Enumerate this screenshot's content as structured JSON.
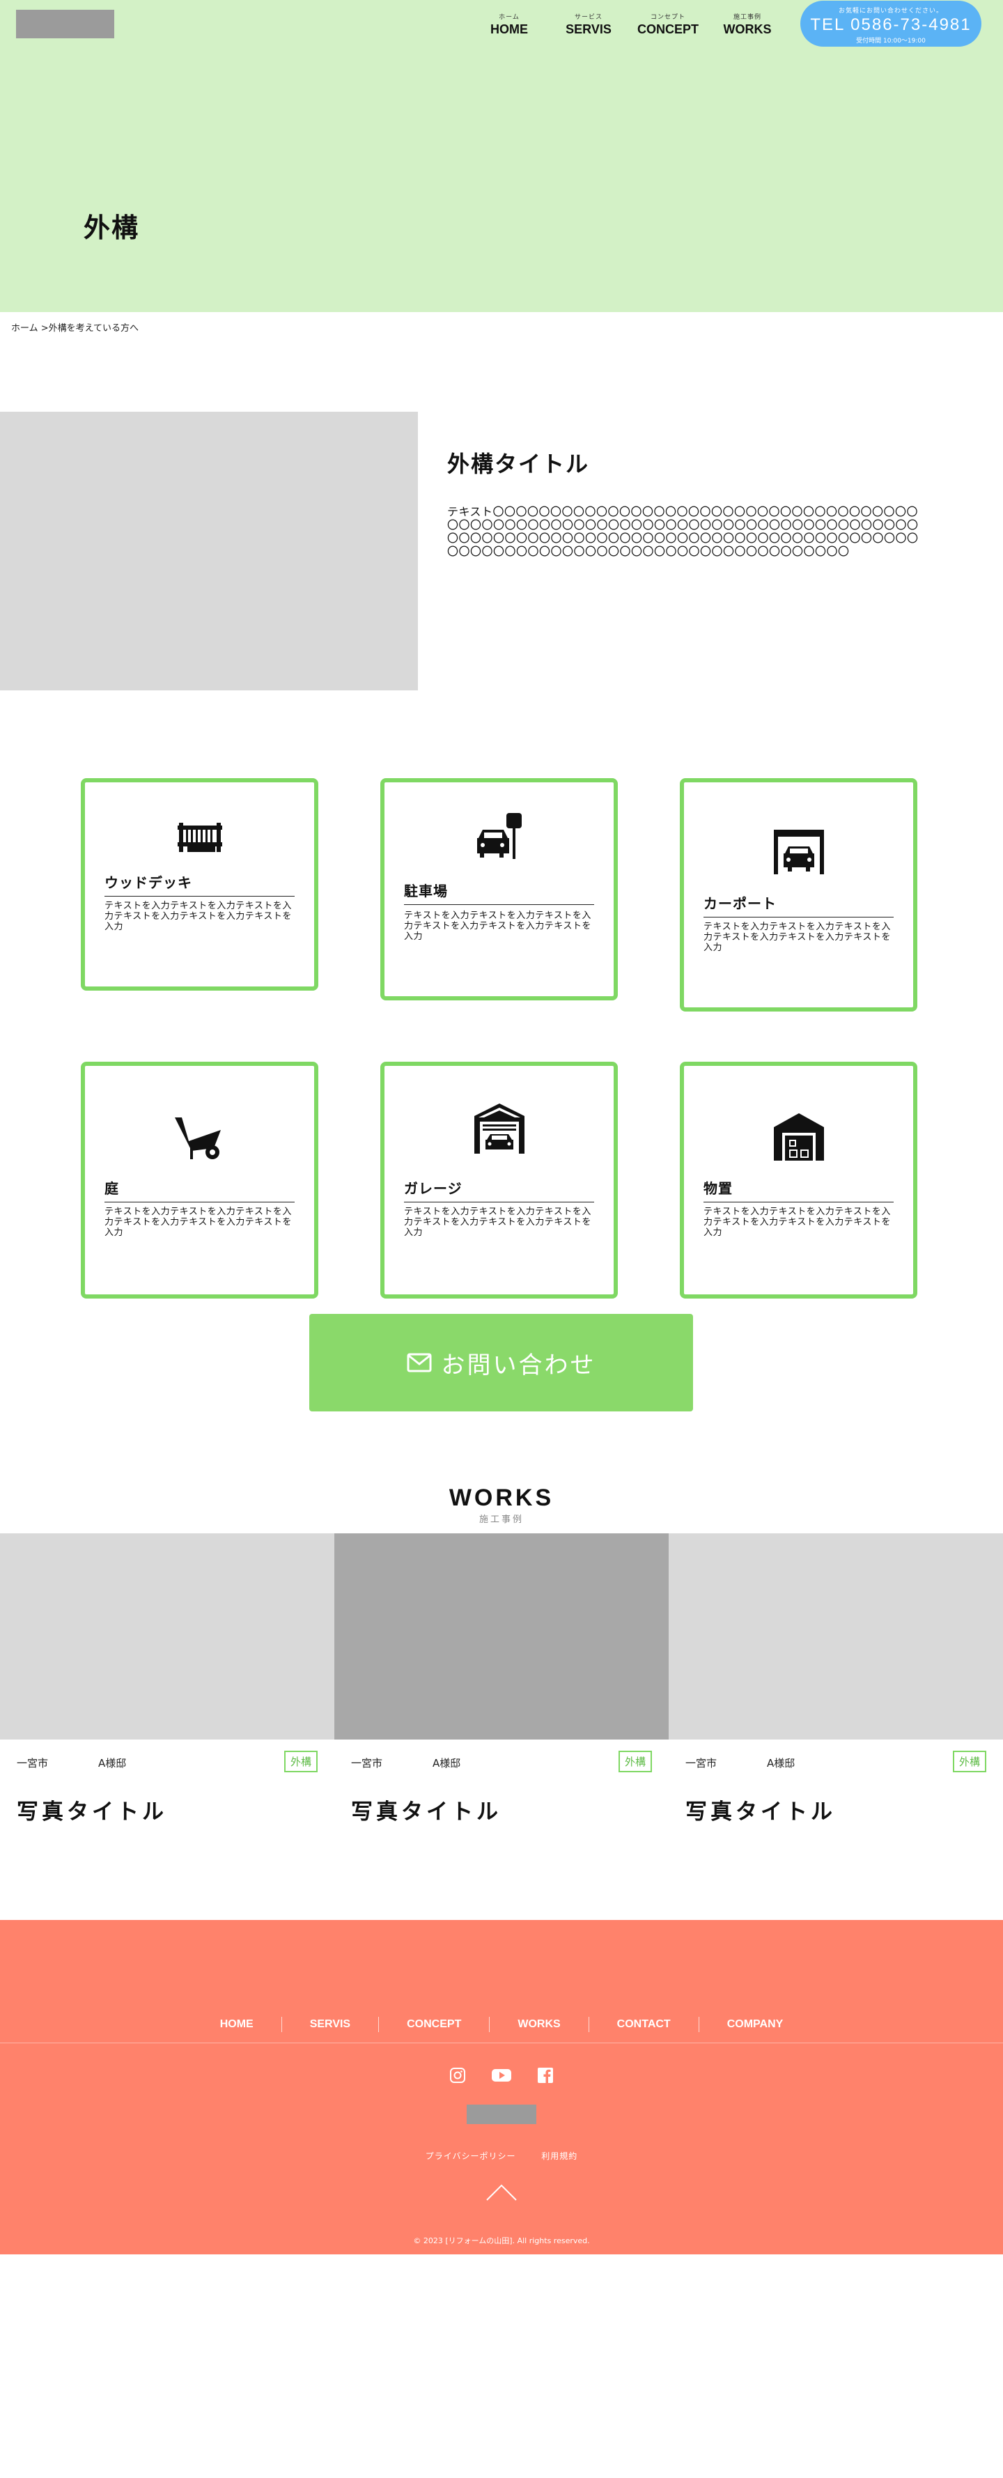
{
  "header": {
    "nav": [
      {
        "sub": "ホーム",
        "label": "HOME"
      },
      {
        "sub": "サービス",
        "label": "SERVIS"
      },
      {
        "sub": "コンセプト",
        "label": "CONCEPT"
      },
      {
        "sub": "施工事例",
        "label": "WORKS"
      }
    ],
    "tel": {
      "note": "お気軽にお問い合わせください。",
      "number": "TEL 0586-73-4981",
      "hours": "受付時間 10:00〜19:00"
    },
    "accent_color": "#d3f1c6",
    "tel_color": "#5bb3f5"
  },
  "hero": {
    "title": "外構"
  },
  "breadcrumb": {
    "home": "ホーム",
    "separator": " >",
    "current": "外構を考えている方へ"
  },
  "intro": {
    "title": "外構タイトル",
    "text": "テキスト〇〇〇〇〇〇〇〇〇〇〇〇〇〇〇〇〇〇〇〇〇〇〇〇〇〇〇〇〇〇〇〇〇〇〇〇〇〇〇〇〇〇〇〇〇〇〇〇〇〇〇〇〇〇〇〇〇〇〇〇〇〇〇〇〇〇〇〇〇〇〇〇〇〇〇〇〇〇〇〇〇〇〇〇〇〇〇〇〇〇〇〇〇〇〇〇〇〇〇〇〇〇〇〇〇〇〇〇〇〇〇〇〇〇〇〇〇〇〇〇〇〇〇〇〇〇〇〇〇〇〇〇〇〇〇〇〇〇〇〇〇〇〇〇〇〇〇〇〇〇〇〇〇〇"
  },
  "services": [
    {
      "icon": "wood-deck-icon",
      "title": "ウッドデッキ",
      "text": "テキストを入力テキストを入力テキストを入力テキストを入力テキストを入力テキストを入力"
    },
    {
      "icon": "parking-icon",
      "title": "駐車場",
      "text": "テキストを入力テキストを入力テキストを入力テキストを入力テキストを入力テキストを入力"
    },
    {
      "icon": "carport-icon",
      "title": "カーポート",
      "text": "テキストを入力テキストを入力テキストを入力テキストを入力テキストを入力テキストを入力"
    },
    {
      "icon": "wheelbarrow-icon",
      "title": "庭",
      "text": "テキストを入力テキストを入力テキストを入力テキストを入力テキストを入力テキストを入力"
    },
    {
      "icon": "garage-icon",
      "title": "ガレージ",
      "text": "テキストを入力テキストを入力テキストを入力テキストを入力テキストを入力テキストを入力"
    },
    {
      "icon": "storage-icon",
      "title": "物置",
      "text": "テキストを入力テキストを入力テキストを入力テキストを入力テキストを入力テキストを入力"
    }
  ],
  "contact": {
    "label": "お問い合わせ",
    "color": "#8ad96a"
  },
  "works": {
    "title": "WORKS",
    "subtitle": "施工事例",
    "items": [
      {
        "area": "一宮市",
        "client": "A様邸",
        "tag": "外構",
        "title": "写真タイトル"
      },
      {
        "area": "一宮市",
        "client": "A様邸",
        "tag": "外構",
        "title": "写真タイトル"
      },
      {
        "area": "一宮市",
        "client": "A様邸",
        "tag": "外構",
        "title": "写真タイトル"
      }
    ]
  },
  "footer": {
    "nav": [
      "HOME",
      "SERVIS",
      "CONCEPT",
      "WORKS",
      "CONTACT",
      "COMPANY"
    ],
    "social": [
      "instagram-icon",
      "youtube-icon",
      "facebook-icon"
    ],
    "links": [
      "プライバシーポリシー",
      "利用規約"
    ],
    "copyright": "© 2023 [リフォームの山田]. All rights reserved.",
    "color": "#ff826b"
  }
}
